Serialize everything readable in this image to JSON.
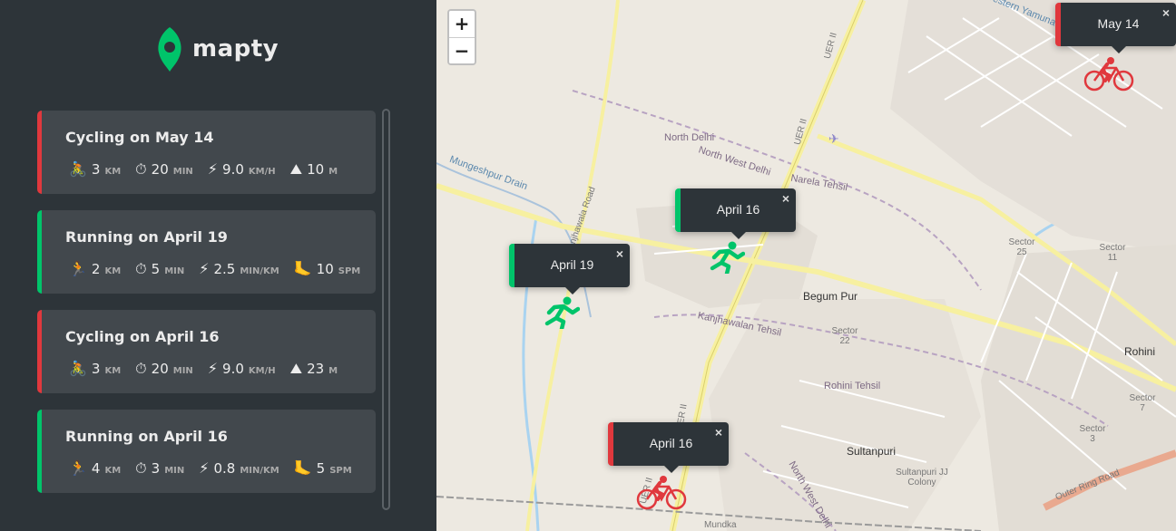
{
  "app": {
    "name": "mapty"
  },
  "colors": {
    "running": "#00c46a",
    "cycling": "#e0383d",
    "sidebar": "#2d3439",
    "card": "#42484d"
  },
  "workouts": [
    {
      "type": "cycling",
      "title": "Cycling on May 14",
      "details": [
        {
          "icon": "cyclist-icon",
          "glyph": "🚴",
          "value": "3",
          "unit": "KM"
        },
        {
          "icon": "stopwatch-icon",
          "glyph": "⏱",
          "value": "20",
          "unit": "MIN"
        },
        {
          "icon": "lightning-icon",
          "glyph": "⚡",
          "value": "9.0",
          "unit": "KM/H"
        },
        {
          "icon": "mountain-icon",
          "glyph": "⛰",
          "value": "10",
          "unit": "M"
        }
      ]
    },
    {
      "type": "running",
      "title": "Running on April 19",
      "details": [
        {
          "icon": "runner-icon",
          "glyph": "🏃",
          "value": "2",
          "unit": "KM"
        },
        {
          "icon": "stopwatch-icon",
          "glyph": "⏱",
          "value": "5",
          "unit": "MIN"
        },
        {
          "icon": "lightning-icon",
          "glyph": "⚡",
          "value": "2.5",
          "unit": "MIN/KM"
        },
        {
          "icon": "footprint-icon",
          "glyph": "🦶",
          "value": "10",
          "unit": "SPM"
        }
      ]
    },
    {
      "type": "cycling",
      "title": "Cycling on April 16",
      "details": [
        {
          "icon": "cyclist-icon",
          "glyph": "🚴",
          "value": "3",
          "unit": "KM"
        },
        {
          "icon": "stopwatch-icon",
          "glyph": "⏱",
          "value": "20",
          "unit": "MIN"
        },
        {
          "icon": "lightning-icon",
          "glyph": "⚡",
          "value": "9.0",
          "unit": "KM/H"
        },
        {
          "icon": "mountain-icon",
          "glyph": "⛰",
          "value": "23",
          "unit": "M"
        }
      ]
    },
    {
      "type": "running",
      "title": "Running on April 16",
      "details": [
        {
          "icon": "runner-icon",
          "glyph": "🏃",
          "value": "4",
          "unit": "KM"
        },
        {
          "icon": "stopwatch-icon",
          "glyph": "⏱",
          "value": "3",
          "unit": "MIN"
        },
        {
          "icon": "lightning-icon",
          "glyph": "⚡",
          "value": "0.8",
          "unit": "MIN/KM"
        },
        {
          "icon": "footprint-icon",
          "glyph": "🦶",
          "value": "5",
          "unit": "SPM"
        }
      ]
    }
  ],
  "map": {
    "zoom_in": "+",
    "zoom_out": "−",
    "popups": [
      {
        "type": "cycling",
        "text": "May 14",
        "close": "×"
      },
      {
        "type": "running",
        "text": "April 16",
        "close": "×"
      },
      {
        "type": "running",
        "text": "April 19",
        "close": "×"
      },
      {
        "type": "cycling",
        "text": "April 16",
        "close": "×"
      }
    ],
    "labels": {
      "begum_pur": "Begum Pur",
      "rohini": "Rohini",
      "sultanpuri": "Sultanpuri",
      "sultanpuri_jj": "Sultanpuri JJ Colony",
      "north_delhi": "North Delhi",
      "north_west_delhi": "North West Delhi",
      "narela_tehsil": "Narela Tehsil",
      "kanjhawalan_tehsil": "Kanjhawalan Tehsil",
      "rohini_tehsil": "Rohini Tehsil",
      "mungeshpur_drain": "Mungeshpur Drain",
      "kanjhawala_road": "Kanjhawala Road",
      "western_yamuna": "Western Yamuna Canal",
      "outer_ring_road": "Outer Ring Road",
      "mundka": "Mundka",
      "uer": "UER II",
      "sector_25": "Sector 25",
      "sector_11": "Sector 11",
      "sector_22": "Sector 22",
      "sector_7": "Sector 7",
      "sector_3": "Sector 3"
    }
  }
}
